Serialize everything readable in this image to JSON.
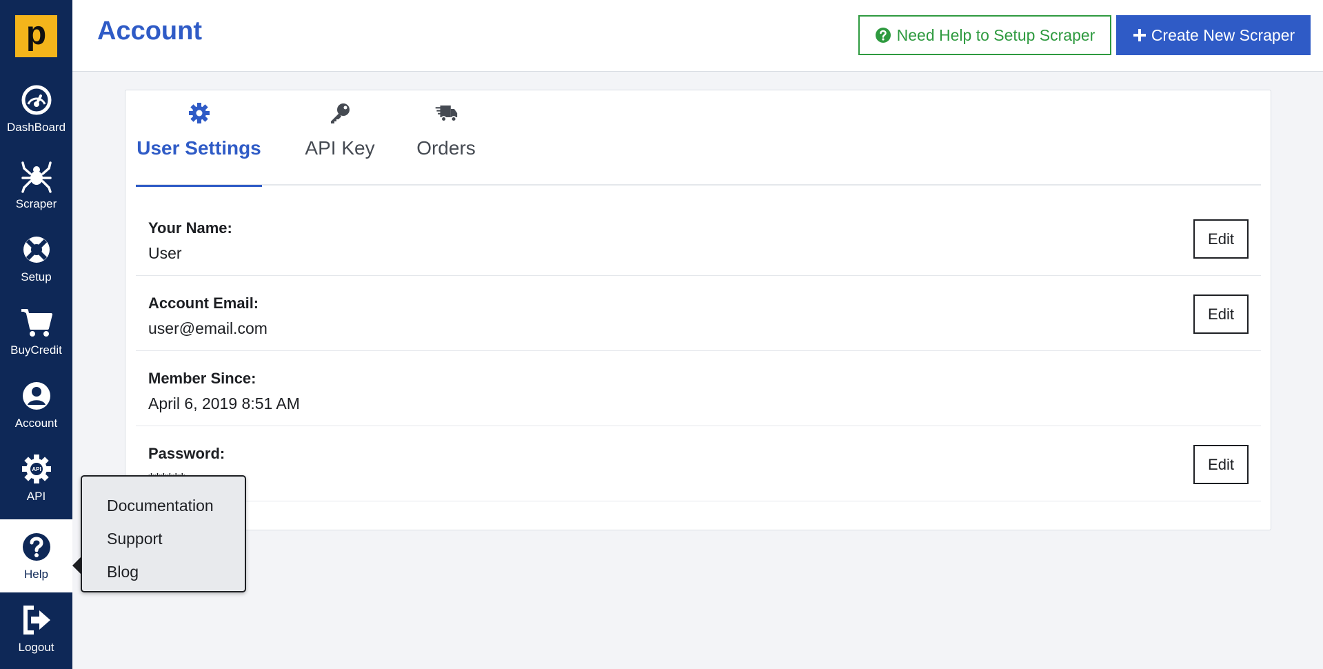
{
  "sidebar": {
    "logo": "p",
    "items": [
      {
        "label": "DashBoard",
        "icon": "dashboard-icon"
      },
      {
        "label": "Scraper",
        "icon": "spider-icon"
      },
      {
        "label": "Setup",
        "icon": "lifebuoy-icon"
      },
      {
        "label": "BuyCredit",
        "icon": "cart-icon"
      },
      {
        "label": "Account",
        "icon": "user-circle-icon"
      },
      {
        "label": "API",
        "icon": "api-gear-icon"
      },
      {
        "label": "Help",
        "icon": "question-circle-icon"
      },
      {
        "label": "Logout",
        "icon": "logout-icon"
      }
    ],
    "active": "Help"
  },
  "header": {
    "title": "Account",
    "help_button": "Need Help to Setup Scraper",
    "create_button": "Create New Scraper"
  },
  "tabs": [
    {
      "label": "User Settings",
      "icon": "gear-icon"
    },
    {
      "label": "API Key",
      "icon": "key-icon"
    },
    {
      "label": "Orders",
      "icon": "truck-icon"
    }
  ],
  "active_tab": "User Settings",
  "fields": [
    {
      "label": "Your Name:",
      "value": "User",
      "action": "Edit"
    },
    {
      "label": "Account Email:",
      "value": "user@email.com",
      "action": "Edit"
    },
    {
      "label": "Member Since:",
      "value": "April 6, 2019 8:51 AM"
    },
    {
      "label": "Password:",
      "value": "******",
      "action": "Edit"
    }
  ],
  "help_menu": {
    "items": [
      "Documentation",
      "Support",
      "Blog"
    ]
  },
  "colors": {
    "sidebar": "#0e2857",
    "accent": "#2f5bc6",
    "logo": "#f4b51b",
    "help_green": "#2e9a3f"
  }
}
